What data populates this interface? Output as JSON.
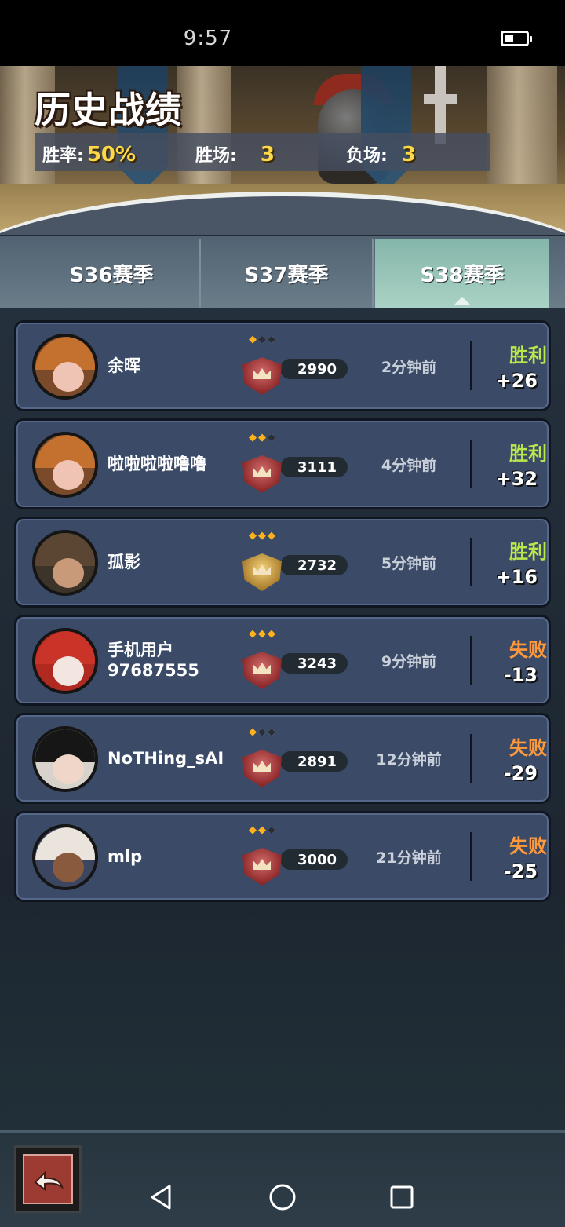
{
  "status_bar": {
    "time": "9:57"
  },
  "header": {
    "title": "历史战绩",
    "win_rate_label": "胜率:",
    "win_rate_value": "50%",
    "wins_label": "胜场:",
    "wins_value": "3",
    "losses_label": "负场:",
    "losses_value": "3"
  },
  "tabs": [
    {
      "label": "S36赛季",
      "active": false
    },
    {
      "label": "S37赛季",
      "active": false
    },
    {
      "label": "S38赛季",
      "active": true
    }
  ],
  "matches": [
    {
      "player": "余晖",
      "stars": 1,
      "score": "2990",
      "time_ago": "2分钟前",
      "result": "胜利",
      "delta": "+26",
      "outcome": "win"
    },
    {
      "player": "啦啦啦啦噜噜",
      "stars": 2,
      "score": "3111",
      "time_ago": "4分钟前",
      "result": "胜利",
      "delta": "+32",
      "outcome": "win"
    },
    {
      "player": "孤影",
      "stars": 3,
      "score": "2732",
      "time_ago": "5分钟前",
      "result": "胜利",
      "delta": "+16",
      "outcome": "win"
    },
    {
      "player": "手机用户97687555",
      "stars": 3,
      "score": "3243",
      "time_ago": "9分钟前",
      "result": "失败",
      "delta": "-13",
      "outcome": "lose"
    },
    {
      "player": "NoTHing_sAI",
      "stars": 1,
      "score": "2891",
      "time_ago": "12分钟前",
      "result": "失败",
      "delta": "-29",
      "outcome": "lose"
    },
    {
      "player": "mlp",
      "stars": 2,
      "score": "3000",
      "time_ago": "21分钟前",
      "result": "失败",
      "delta": "-25",
      "outcome": "lose"
    }
  ],
  "icons": {
    "back": "return-arrow-icon",
    "nav_back": "triangle-back-icon",
    "nav_home": "circle-home-icon",
    "nav_recent": "square-recent-icon"
  },
  "colors": {
    "win": "#b9e84a",
    "lose": "#ff9a3c",
    "rank_star": "#ffb21e",
    "stat_value": "#ffd84a"
  }
}
